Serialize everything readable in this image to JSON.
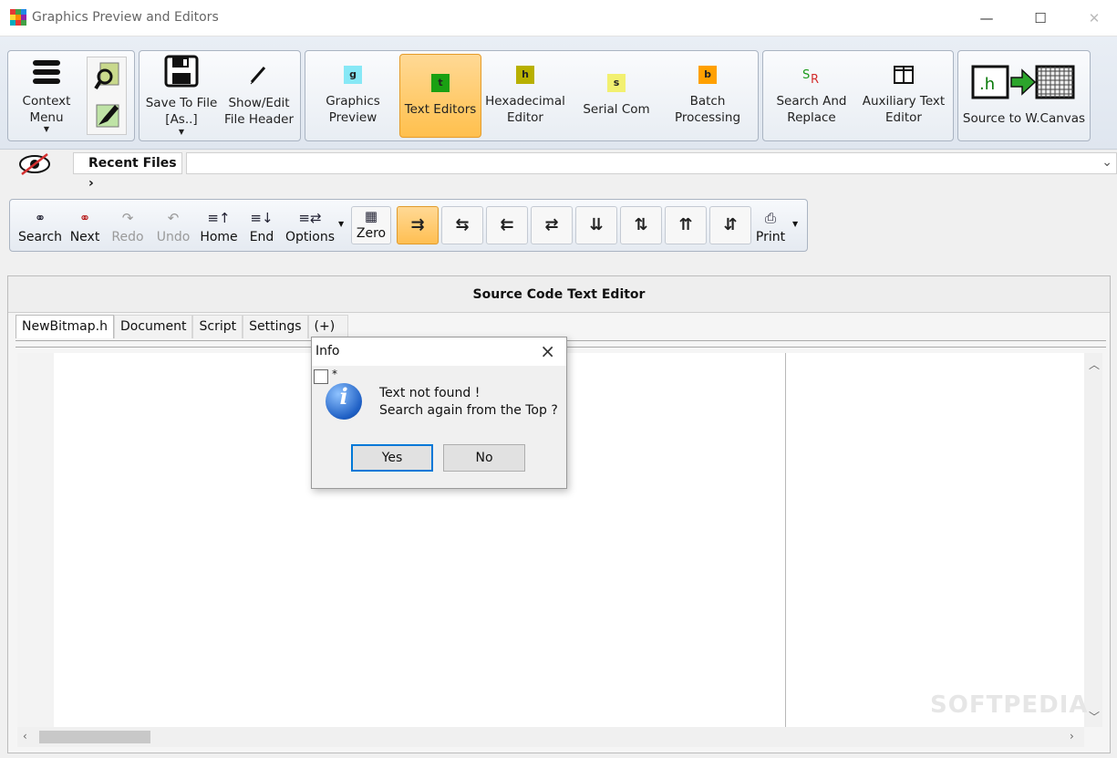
{
  "window": {
    "title": "Graphics Preview and Editors",
    "minimize_glyph": "—",
    "maximize_glyph": "☐",
    "close_glyph": "✕"
  },
  "ribbon": {
    "context_menu_label": [
      "Context",
      "Menu"
    ],
    "save_label": [
      "Save To File",
      "[As..]"
    ],
    "show_edit_label": [
      "Show/Edit",
      "File Header"
    ],
    "graphics_preview": {
      "chip": "g",
      "label": [
        "Graphics",
        "Preview"
      ],
      "color": "#87e8f6"
    },
    "text_editors": {
      "chip": "t",
      "label": [
        "Text Editors"
      ],
      "color": "#1aa012"
    },
    "hexadecimal_editor": {
      "chip": "h",
      "label": [
        "Hexadecimal",
        "Editor"
      ],
      "color": "#b8b000"
    },
    "serial_com": {
      "chip": "s",
      "label": [
        "Serial Com"
      ],
      "color": "#f2f070"
    },
    "batch_processing": {
      "chip": "b",
      "label": [
        "Batch",
        "Processing"
      ],
      "color": "#ffa000"
    },
    "search_replace": {
      "label": [
        "Search And",
        "Replace"
      ]
    },
    "auxiliary_editor": {
      "label": [
        "Auxiliary Text",
        "Editor"
      ]
    },
    "source_to_canvas": {
      "label": [
        "Source to W.Canvas"
      ],
      "chip": ".h"
    }
  },
  "recent_files": {
    "label": "Recent Files ›"
  },
  "editor_toolbar": {
    "search": "Search",
    "next": "Next",
    "redo": "Redo",
    "undo": "Undo",
    "home": "Home",
    "end": "End",
    "options": "Options",
    "zero": "Zero",
    "print": "Print",
    "arrows": [
      "⇉",
      "⇆",
      "⇇",
      "⇄",
      "⇊",
      "⇅",
      "⇈",
      "⇵"
    ]
  },
  "editor": {
    "header": "Source Code Text Editor",
    "tabs": [
      "NewBitmap.h",
      "Document",
      "Script",
      "Settings",
      "(+)"
    ]
  },
  "dialog": {
    "title": "Info",
    "checkbox_label": "*",
    "message_line1": "Text not found !",
    "message_line2": "Search again from the Top ?",
    "yes_label": "Yes",
    "no_label": "No"
  },
  "watermark": "SOFTPEDIA"
}
